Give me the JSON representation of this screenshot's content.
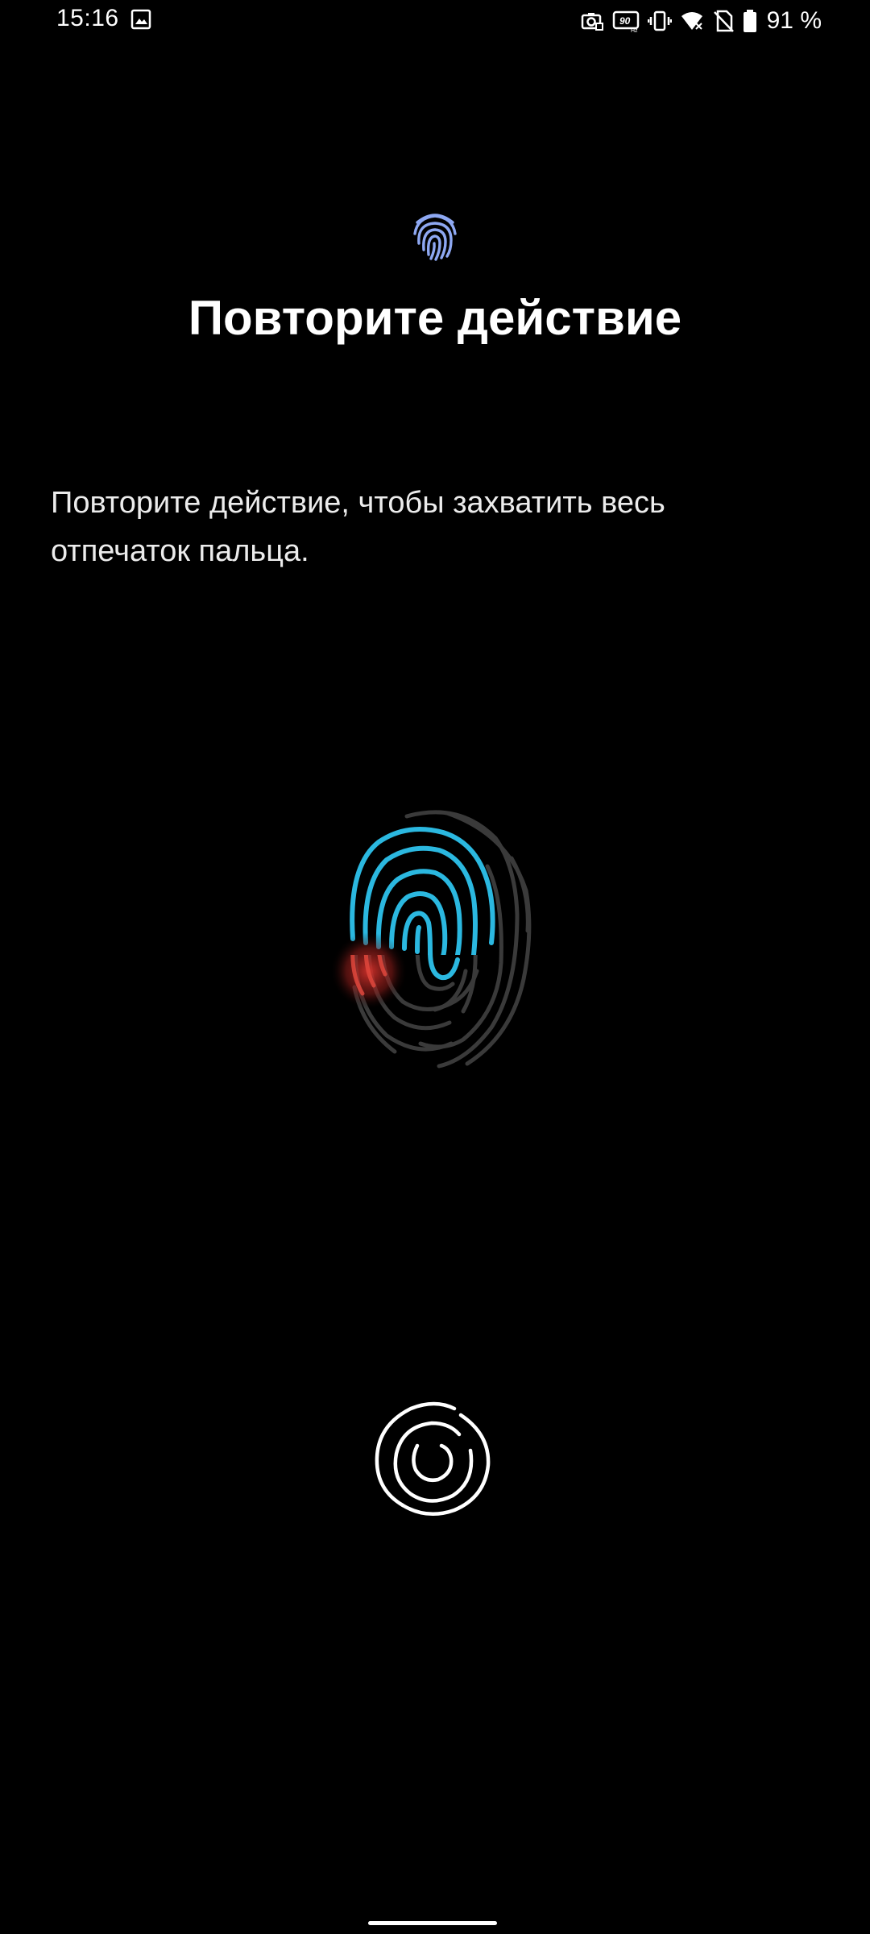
{
  "status_bar": {
    "time": "15:16",
    "battery_percent": "91 %",
    "icons": [
      "gallery-icon",
      "screenshot-icon",
      "refresh-rate-icon",
      "vibrate-icon",
      "wifi-icon",
      "no-sim-icon",
      "battery-icon"
    ],
    "refresh_rate_label": "90",
    "refresh_rate_unit": "Hz"
  },
  "header": {
    "icon": "fingerprint-icon",
    "title": "Повторите действие"
  },
  "body": {
    "description": "Повторите действие, чтобы захватить весь отпечаток пальца."
  },
  "illustration": {
    "icon": "fingerprint-progress-illustration",
    "progress_color": "#2bb8e0",
    "touch_color": "#c0302a",
    "remaining_color": "#3a3a3a"
  },
  "sensor": {
    "icon": "fingerprint-sensor-icon"
  },
  "colors": {
    "background": "#000000",
    "text": "#ffffff",
    "accent_icon": "#8ea8f2"
  }
}
